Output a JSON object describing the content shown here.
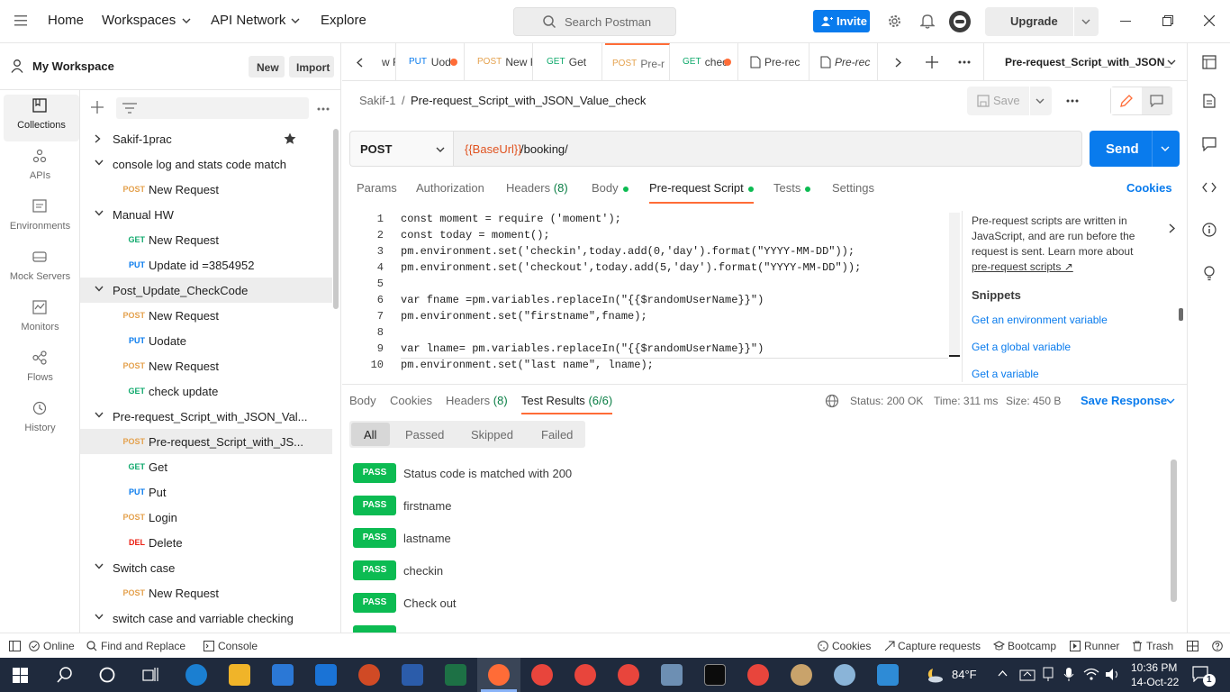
{
  "header": {
    "nav": [
      "Home",
      "Workspaces",
      "API Network",
      "Explore"
    ],
    "search_placeholder": "Search Postman",
    "invite_label": "Invite",
    "upgrade_label": "Upgrade"
  },
  "workspace": {
    "name": "My Workspace",
    "new_label": "New",
    "import_label": "Import"
  },
  "rail": [
    "Collections",
    "APIs",
    "Environments",
    "Mock Servers",
    "Monitors",
    "Flows",
    "History"
  ],
  "tree": [
    {
      "type": "collection",
      "label": "Sakif-1prac",
      "expanded": false,
      "starred": true
    },
    {
      "type": "collection",
      "label": "console log and stats code match",
      "expanded": true
    },
    {
      "type": "request",
      "method": "POST",
      "label": "New Request"
    },
    {
      "type": "collection",
      "label": "Manual HW",
      "expanded": true
    },
    {
      "type": "request",
      "method": "GET",
      "label": "New Request"
    },
    {
      "type": "request",
      "method": "PUT",
      "label": "Update id =3854952"
    },
    {
      "type": "collection",
      "label": "Post_Update_CheckCode",
      "expanded": true
    },
    {
      "type": "request",
      "method": "POST",
      "label": "New Request"
    },
    {
      "type": "request",
      "method": "PUT",
      "label": "Uodate"
    },
    {
      "type": "request",
      "method": "POST",
      "label": "New Request"
    },
    {
      "type": "request",
      "method": "GET",
      "label": "check update"
    },
    {
      "type": "collection",
      "label": "Pre-request_Script_with_JSON_Val...",
      "expanded": true
    },
    {
      "type": "request",
      "method": "POST",
      "label": "Pre-request_Script_with_JS...",
      "selected": true
    },
    {
      "type": "request",
      "method": "GET",
      "label": "Get"
    },
    {
      "type": "request",
      "method": "PUT",
      "label": "Put"
    },
    {
      "type": "request",
      "method": "POST",
      "label": "Login"
    },
    {
      "type": "request",
      "method": "DEL",
      "label": "Delete"
    },
    {
      "type": "collection",
      "label": "Switch case",
      "expanded": true
    },
    {
      "type": "request",
      "method": "POST",
      "label": "New Request"
    },
    {
      "type": "collection",
      "label": "switch case and varriable checking",
      "expanded": true
    }
  ],
  "tabs": [
    {
      "method": "",
      "label": "w F",
      "dot": false
    },
    {
      "method": "PUT",
      "label": "Uod",
      "dot": true
    },
    {
      "method": "POST",
      "label": "New F",
      "dot": false
    },
    {
      "method": "GET",
      "label": "Get",
      "dot": false
    },
    {
      "method": "POST",
      "label": "Pre-r",
      "dot": false,
      "active": true
    },
    {
      "method": "GET",
      "label": "chec",
      "dot": true
    },
    {
      "method": "",
      "label": "Pre-rec",
      "dot": false
    },
    {
      "method": "",
      "label": "Pre-rec",
      "dot": false
    }
  ],
  "env_selector": "Pre-request_Script_with_JSON_",
  "breadcrumb": {
    "collection": "Sakif-1",
    "sep": "/",
    "request": "Pre-request_Script_with_JSON_Value_check"
  },
  "save_label": "Save",
  "request": {
    "method": "POST",
    "url_var": "{{BaseUrl}}",
    "url_path": "/booking/",
    "send_label": "Send"
  },
  "req_tabs": {
    "params": "Params",
    "authorization": "Authorization",
    "headers": "Headers",
    "headers_count": "(8)",
    "body": "Body",
    "prerequest": "Pre-request Script",
    "tests": "Tests",
    "settings": "Settings",
    "cookies": "Cookies"
  },
  "code_lines": [
    "const moment = require ('moment');",
    "const today = moment();",
    "pm.environment.set('checkin',today.add(0,'day').format(\"YYYY-MM-DD\"));",
    "pm.environment.set('checkout',today.add(5,'day').format(\"YYYY-MM-DD\"));",
    "",
    "var fname =pm.variables.replaceIn(\"{{$randomUserName}}\")",
    "pm.environment.set(\"firstname\",fname);",
    "",
    "var lname= pm.variables.replaceIn(\"{{$randomUserName}}\")",
    "pm.environment.set(\"last name\", lname);"
  ],
  "line_numbers": [
    "1",
    "2",
    "3",
    "4",
    "5",
    "6",
    "7",
    "8",
    "9",
    "10"
  ],
  "snippets": {
    "description": "Pre-request scripts are written in JavaScript, and are run before the request is sent. Learn more about",
    "link": "pre-request scripts ↗",
    "title": "Snippets",
    "items": [
      "Get an environment variable",
      "Get a global variable",
      "Get a variable"
    ]
  },
  "response": {
    "tabs": {
      "body": "Body",
      "cookies": "Cookies",
      "headers": "Headers",
      "headers_count": "(8)",
      "tests": "Test Results",
      "tests_count": "(6/6)"
    },
    "status": "Status: 200 OK",
    "time": "Time: 311 ms",
    "size": "Size: 450 B",
    "save_response": "Save Response",
    "filters": [
      "All",
      "Passed",
      "Skipped",
      "Failed"
    ],
    "results": [
      {
        "badge": "PASS",
        "name": "Status code is matched with 200"
      },
      {
        "badge": "PASS",
        "name": "firstname"
      },
      {
        "badge": "PASS",
        "name": "lastname"
      },
      {
        "badge": "PASS",
        "name": "checkin"
      },
      {
        "badge": "PASS",
        "name": "Check out"
      }
    ]
  },
  "statusbar": {
    "online": "Online",
    "find_replace": "Find and Replace",
    "console": "Console",
    "cookies": "Cookies",
    "capture": "Capture requests",
    "bootcamp": "Bootcamp",
    "runner": "Runner",
    "trash": "Trash"
  },
  "taskbar": {
    "weather": "84°F",
    "time": "10:36 PM",
    "date": "14-Oct-22",
    "notifications": "1"
  },
  "colors": {
    "accent": "#ff6c37",
    "primary": "#097bed",
    "pass": "#0cbb52",
    "post": "#e4a14d",
    "get": "#0fa96c",
    "put": "#097bed",
    "delete": "#eb2013"
  }
}
